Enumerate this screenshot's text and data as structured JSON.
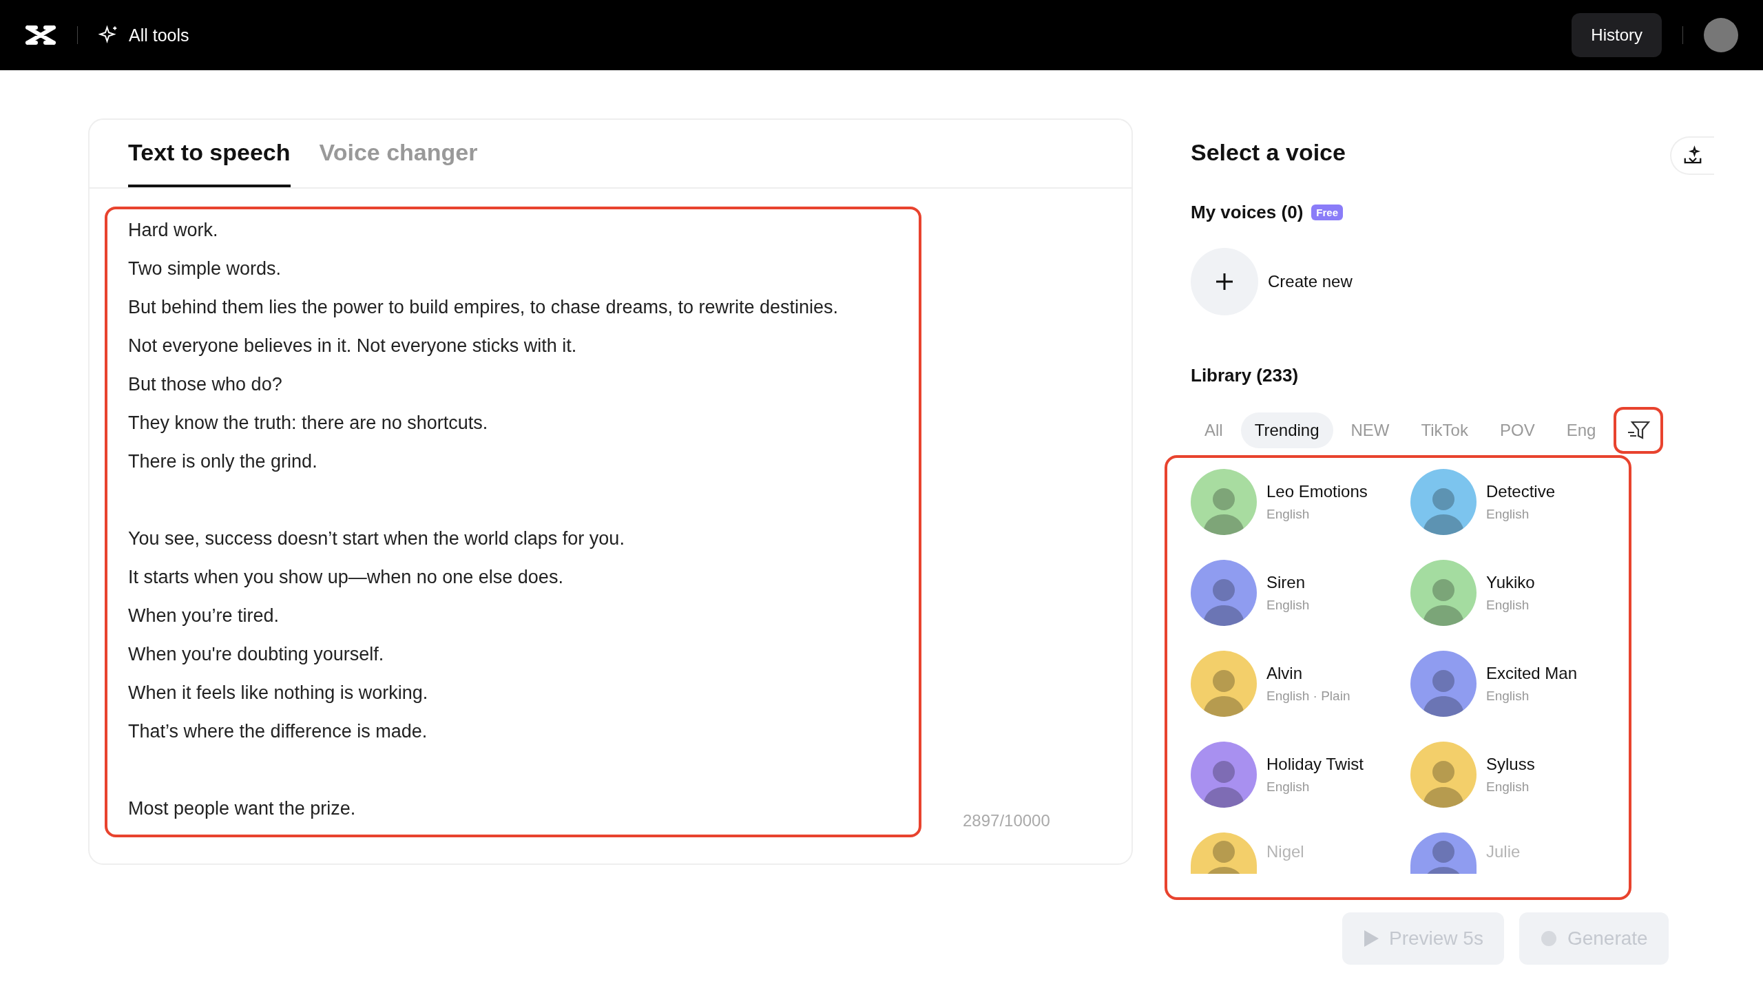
{
  "top_bar": {
    "tools_label": "All tools",
    "history_button": "History"
  },
  "tabs": [
    {
      "label": "Text to speech",
      "selected": true
    },
    {
      "label": "Voice changer",
      "selected": false
    }
  ],
  "editor": {
    "highlighted": true,
    "paragraphs": [
      [
        "Hard work.",
        "Two simple words.",
        "But behind them lies the power to build empires, to chase dreams, to rewrite destinies.",
        "Not everyone believes in it. Not everyone sticks with it.",
        "But those who do?",
        "They know the truth: there are no shortcuts.",
        "There is only the grind."
      ],
      [
        "You see, success doesn’t start when the world claps for you.",
        "It starts when you show up—when no one else does.",
        "When you’re tired.",
        "When you're doubting yourself.",
        "When it feels like nothing is working.",
        "That’s where the difference is made."
      ],
      [
        "Most people want the prize."
      ]
    ],
    "counter": "2897/10000"
  },
  "voice_panel": {
    "title": "Select a voice",
    "my_voices": {
      "label": "My voices (0)",
      "badge": "Free",
      "create_label": "Create new"
    },
    "library": {
      "label": "Library (233)",
      "filters": [
        {
          "label": "All",
          "selected": false
        },
        {
          "label": "Trending",
          "selected": true
        },
        {
          "label": "NEW",
          "selected": false
        },
        {
          "label": "TikTok",
          "selected": false
        },
        {
          "label": "POV",
          "selected": false
        },
        {
          "label": "Eng",
          "selected": false
        }
      ],
      "filter_button_highlighted": true,
      "list_highlighted": true,
      "voices": [
        {
          "name": "Leo Emotions",
          "language": "English",
          "color": "#a8dca0",
          "faded": false
        },
        {
          "name": "Detective",
          "language": "English",
          "color": "#7cc4ee",
          "faded": false
        },
        {
          "name": "Siren",
          "language": "English",
          "color": "#8f9cf0",
          "faded": false
        },
        {
          "name": "Yukiko",
          "language": "English",
          "color": "#a4dca0",
          "faded": false
        },
        {
          "name": "Alvin",
          "language": "English · Plain",
          "color": "#f3cf6a",
          "faded": false
        },
        {
          "name": "Excited Man",
          "language": "English",
          "color": "#8f9cf0",
          "faded": false
        },
        {
          "name": "Holiday Twist",
          "language": "English",
          "color": "#a890f0",
          "faded": false
        },
        {
          "name": "Syluss",
          "language": "English",
          "color": "#f3cf6a",
          "faded": false
        },
        {
          "name": "Nigel",
          "color": "#f3cf6a",
          "faded": true
        },
        {
          "name": "Julie",
          "color": "#8f9cf0",
          "faded": true
        }
      ]
    },
    "actions": [
      {
        "kind": "preview",
        "label": "Preview 5s",
        "disabled": true
      },
      {
        "kind": "generate",
        "label": "Generate",
        "disabled": true
      }
    ]
  }
}
